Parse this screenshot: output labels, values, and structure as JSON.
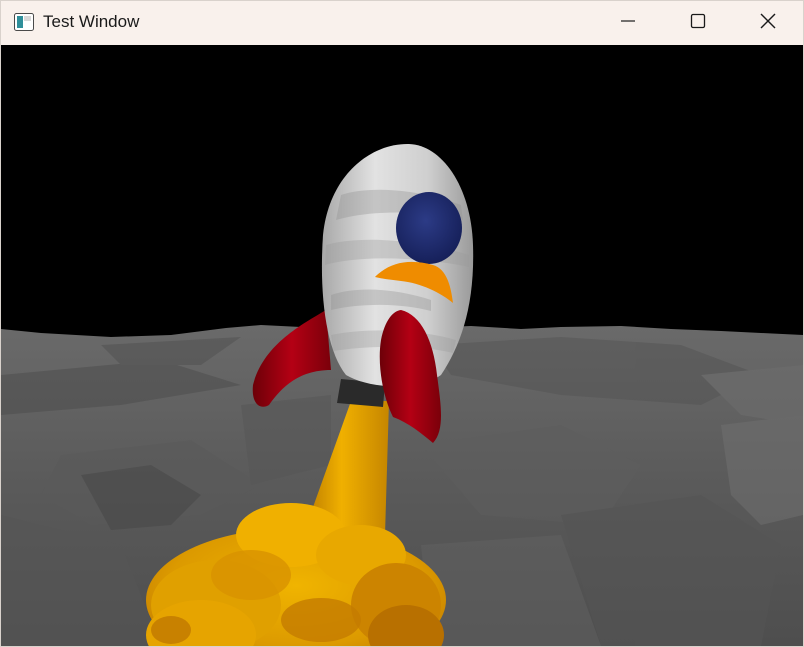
{
  "window": {
    "title": "Test Window",
    "app_icon": "window-app-icon",
    "controls": {
      "minimize_icon": "minimize-icon",
      "maximize_icon": "maximize-icon",
      "close_icon": "close-icon"
    }
  },
  "scene": {
    "sky_color": "#000000",
    "ground_color": "#5f5f5f",
    "rocket": {
      "body_color": "#c8c8c8",
      "window_color": "#1e2a6e",
      "fin_color": "#a40010",
      "accent_color": "#ef8c00",
      "exhaust_color": "#e6a800"
    }
  }
}
